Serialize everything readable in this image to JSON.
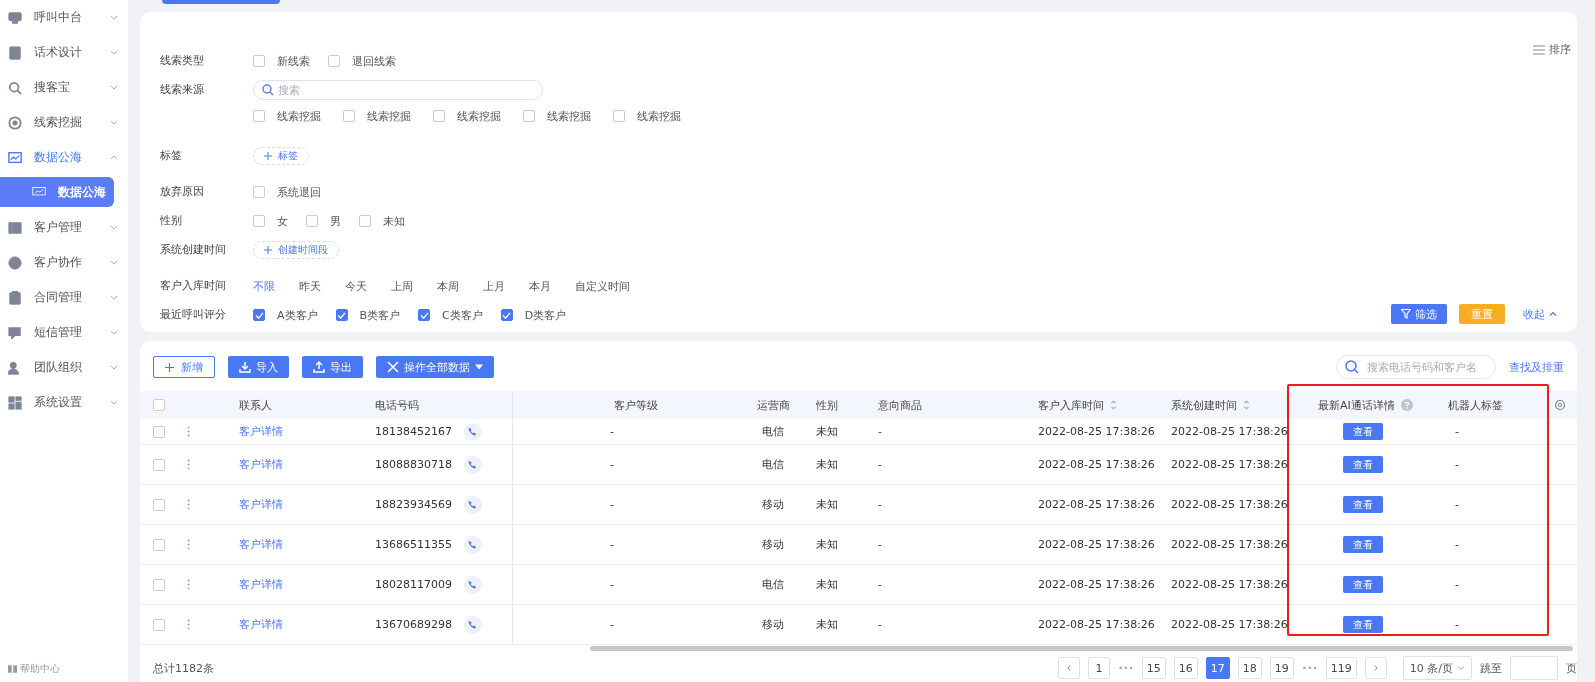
{
  "sidebar": {
    "items": [
      {
        "label": "呼叫中台",
        "expanded": false,
        "selected": false
      },
      {
        "label": "话术设计",
        "expanded": false,
        "selected": false
      },
      {
        "label": "搜客宝",
        "expanded": false,
        "selected": false
      },
      {
        "label": "线索挖掘",
        "expanded": false,
        "selected": false
      },
      {
        "label": "数据公海",
        "expanded": true,
        "selected": true,
        "children": [
          {
            "label": "数据公海",
            "selected": true
          }
        ]
      },
      {
        "label": "客户管理",
        "expanded": false,
        "selected": false
      },
      {
        "label": "客户协作",
        "expanded": false,
        "selected": false
      },
      {
        "label": "合同管理",
        "expanded": false,
        "selected": false
      },
      {
        "label": "短信管理",
        "expanded": false,
        "selected": false
      },
      {
        "label": "团队组织",
        "expanded": false,
        "selected": false
      },
      {
        "label": "系统设置",
        "expanded": false,
        "selected": false
      }
    ],
    "help": "帮助中心"
  },
  "filters": {
    "sort": "排序",
    "rows": [
      {
        "label": "线索类型",
        "kind": "checkbox",
        "options": [
          {
            "label": "新线索",
            "checked": false
          },
          {
            "label": "退回线索",
            "checked": false
          }
        ]
      },
      {
        "label": "线索来源",
        "kind": "search",
        "placeholder": "搜索",
        "options": [
          {
            "label": "线索挖掘",
            "checked": false
          },
          {
            "label": "线索挖掘",
            "checked": false
          },
          {
            "label": "线索挖掘",
            "checked": false
          },
          {
            "label": "线索挖掘",
            "checked": false
          },
          {
            "label": "线索挖掘",
            "checked": false
          }
        ]
      },
      {
        "label": "标签",
        "kind": "add",
        "button": "标签"
      },
      {
        "label": "放弃原因",
        "kind": "checkbox",
        "options": [
          {
            "label": "系统退回",
            "checked": false
          }
        ]
      },
      {
        "label": "性别",
        "kind": "checkbox",
        "options": [
          {
            "label": "女",
            "checked": false
          },
          {
            "label": "男",
            "checked": false
          },
          {
            "label": "未知",
            "checked": false
          }
        ]
      },
      {
        "label": "系统创建时间",
        "kind": "add",
        "button": "创建时间段"
      },
      {
        "label": "客户入库时间",
        "kind": "choice",
        "options": [
          {
            "label": "不限",
            "selected": true
          },
          {
            "label": "昨天",
            "selected": false
          },
          {
            "label": "今天",
            "selected": false
          },
          {
            "label": "上周",
            "selected": false
          },
          {
            "label": "本周",
            "selected": false
          },
          {
            "label": "上月",
            "selected": false
          },
          {
            "label": "本月",
            "selected": false
          },
          {
            "label": "自定义时间",
            "selected": false
          }
        ]
      },
      {
        "label": "最近呼叫评分",
        "kind": "checkbox",
        "options": [
          {
            "label": "A类客户",
            "checked": true
          },
          {
            "label": "B类客户",
            "checked": true
          },
          {
            "label": "C类客户",
            "checked": true
          },
          {
            "label": "D类客户",
            "checked": true
          }
        ]
      }
    ],
    "buttons": {
      "filter": "筛选",
      "reset": "重置",
      "collapse": "收起"
    }
  },
  "toolbar": {
    "add": "新增",
    "import": "导入",
    "export": "导出",
    "bulk": "操作全部数据",
    "search_placeholder": "搜索电话号码和客户名",
    "search_link": "查找及排重"
  },
  "table": {
    "select_all_checked": false,
    "columns": [
      "联系人",
      "电话号码",
      "客户等级",
      "运营商",
      "性别",
      "意向商品",
      "客户入库时间",
      "系统创建时间",
      "最新AI通话详情",
      "机器人标签"
    ],
    "rows": [
      {
        "contact": "客户详情",
        "phone": "18138452167",
        "level": "-",
        "carrier": "电信",
        "gender": "未知",
        "product": "-",
        "stored": "2022-08-25 17:38:26",
        "created": "2022-08-25 17:38:26",
        "ai": "查看",
        "robot": "-",
        "checked": false
      },
      {
        "contact": "客户详情",
        "phone": "18088830718",
        "level": "-",
        "carrier": "电信",
        "gender": "未知",
        "product": "-",
        "stored": "2022-08-25 17:38:26",
        "created": "2022-08-25 17:38:26",
        "ai": "查看",
        "robot": "-",
        "checked": false
      },
      {
        "contact": "客户详情",
        "phone": "18823934569",
        "level": "-",
        "carrier": "移动",
        "gender": "未知",
        "product": "-",
        "stored": "2022-08-25 17:38:26",
        "created": "2022-08-25 17:38:26",
        "ai": "查看",
        "robot": "-",
        "checked": false
      },
      {
        "contact": "客户详情",
        "phone": "13686511355",
        "level": "-",
        "carrier": "移动",
        "gender": "未知",
        "product": "-",
        "stored": "2022-08-25 17:38:26",
        "created": "2022-08-25 17:38:26",
        "ai": "查看",
        "robot": "-",
        "checked": false
      },
      {
        "contact": "客户详情",
        "phone": "18028117009",
        "level": "-",
        "carrier": "电信",
        "gender": "未知",
        "product": "-",
        "stored": "2022-08-25 17:38:26",
        "created": "2022-08-25 17:38:26",
        "ai": "查看",
        "robot": "-",
        "checked": false
      },
      {
        "contact": "客户详情",
        "phone": "13670689298",
        "level": "-",
        "carrier": "移动",
        "gender": "未知",
        "product": "-",
        "stored": "2022-08-25 17:38:26",
        "created": "2022-08-25 17:38:26",
        "ai": "查看",
        "robot": "-",
        "checked": false
      }
    ]
  },
  "footer": {
    "total": "总计1182条",
    "pages": [
      {
        "label": "1",
        "kind": "page",
        "selected": false
      },
      {
        "label": "•••",
        "kind": "more",
        "selected": false
      },
      {
        "label": "15",
        "kind": "page",
        "selected": false
      },
      {
        "label": "16",
        "kind": "page",
        "selected": false
      },
      {
        "label": "17",
        "kind": "page",
        "selected": true
      },
      {
        "label": "18",
        "kind": "page",
        "selected": false
      },
      {
        "label": "19",
        "kind": "page",
        "selected": false
      },
      {
        "label": "•••",
        "kind": "more",
        "selected": false
      },
      {
        "label": "119",
        "kind": "page",
        "selected": false
      }
    ],
    "page_size": "10 条/页",
    "jump": "跳至",
    "page_unit": "页"
  }
}
